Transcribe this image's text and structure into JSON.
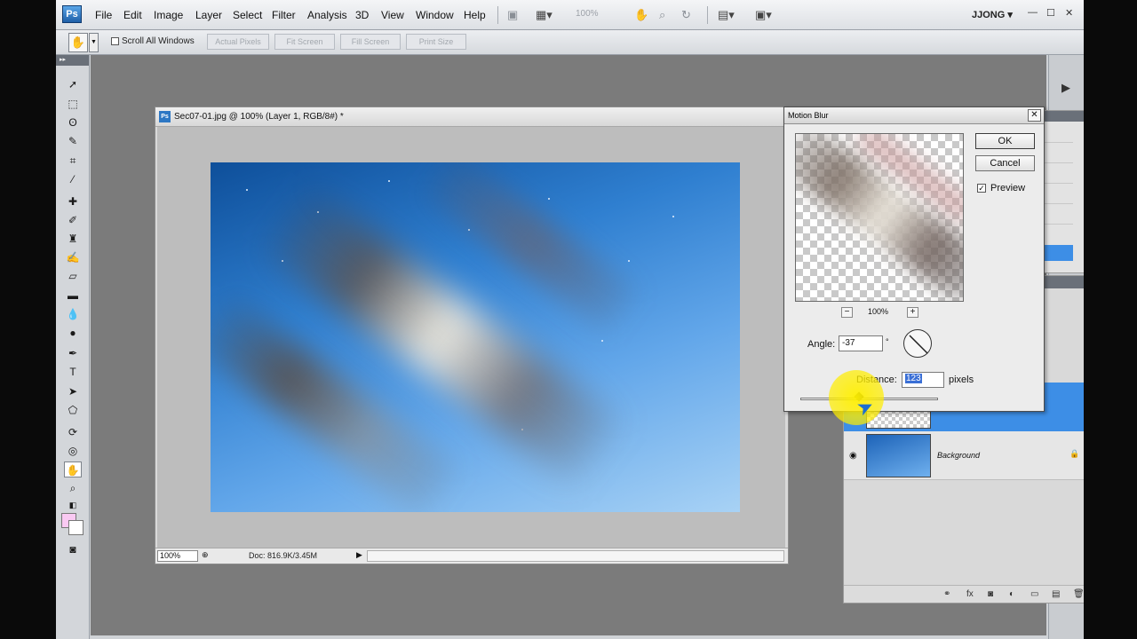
{
  "menubar": {
    "logo": "Ps",
    "items": [
      "File",
      "Edit",
      "Image",
      "Layer",
      "Select",
      "Filter",
      "Analysis",
      "3D",
      "View",
      "Window",
      "Help"
    ],
    "zoom": "100%",
    "user": "JJONG",
    "user_arrow": "▾"
  },
  "options": {
    "scroll_all_windows": "Scroll All Windows",
    "buttons": [
      "Actual Pixels",
      "Fit Screen",
      "Fill Screen",
      "Print Size"
    ]
  },
  "document": {
    "title": "Sec07-01.jpg @ 100% (Layer 1, RGB/8#) *",
    "zoom": "100%",
    "doc_info": "Doc: 816.9K/3.45M"
  },
  "layers": {
    "background_name": "Background"
  },
  "dialog": {
    "title": "Motion Blur",
    "ok": "OK",
    "cancel": "Cancel",
    "preview_label": "Preview",
    "preview_checked": true,
    "zoom": "100%",
    "angle_label": "Angle:",
    "angle_value": "-37",
    "angle_unit": "°",
    "distance_label": "Distance:",
    "distance_value": "123",
    "distance_unit": "pixels"
  },
  "colors": {
    "foreground": "#f9c9f2",
    "background": "#ffffff",
    "selection": "#3d8ee6"
  },
  "icons": {
    "close": "close-icon",
    "hand": "hand-tool-icon"
  }
}
